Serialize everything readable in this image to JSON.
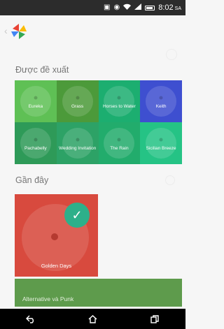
{
  "status_bar": {
    "time": "8:02",
    "ampm": "SA",
    "icons": [
      "nfc-icon",
      "vibrate-icon",
      "wifi-icon",
      "signal-icon",
      "battery-icon"
    ]
  },
  "header": {
    "logo": "music-app-logo",
    "back_icon": "back-chevron-icon"
  },
  "suggested": {
    "title": "Được đề xuất",
    "tiles": [
      {
        "label": "Eureka",
        "color": "#5fc055"
      },
      {
        "label": "Grass",
        "color": "#4c9a3a"
      },
      {
        "label": "Horses to Water",
        "color": "#1cae70"
      },
      {
        "label": "Keith",
        "color": "#3e4fd0"
      },
      {
        "label": "Pachabelly",
        "color": "#2e9a58"
      },
      {
        "label": "Wedding Invitation",
        "color": "#2da266"
      },
      {
        "label": "The Rain",
        "color": "#22ac6c"
      },
      {
        "label": "Sicilian Breeze",
        "color": "#25c385"
      }
    ]
  },
  "recent": {
    "title": "Gần đây",
    "card": {
      "label": "Golden Days",
      "color": "#d84a3e",
      "selected": true
    }
  },
  "genre": {
    "label": "Alternative và Punk",
    "color": "#5e9b4c"
  },
  "nav": {
    "back": "back-icon",
    "home": "home-icon",
    "recents": "recents-icon"
  }
}
